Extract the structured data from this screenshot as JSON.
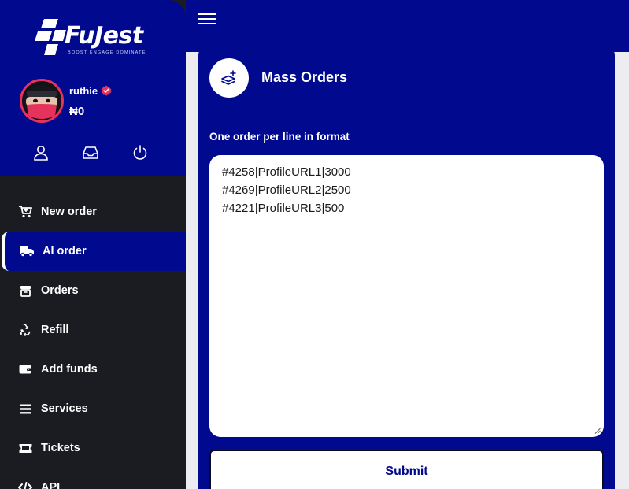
{
  "brand": {
    "name": "FuJest",
    "tagline": "BOOST  ENGAGE  DOMINATE"
  },
  "user": {
    "name": "ruthie",
    "balance": "₦0"
  },
  "nav": [
    {
      "label": "New order",
      "icon": "cart-icon"
    },
    {
      "label": "AI order",
      "icon": "truck-icon",
      "active": true
    },
    {
      "label": "Orders",
      "icon": "box-icon"
    },
    {
      "label": "Refill",
      "icon": "recycle-icon"
    },
    {
      "label": "Add funds",
      "icon": "wallet-icon"
    },
    {
      "label": "Services",
      "icon": "list-icon"
    },
    {
      "label": "Tickets",
      "icon": "ticket-icon"
    },
    {
      "label": "API",
      "icon": "code-icon"
    }
  ],
  "main": {
    "title": "Mass Orders",
    "format_label": "One order per line in format",
    "orders_text": "#4258|ProfileURL1|3000\n#4269|ProfileURL2|2500\n#4221|ProfileURL3|500",
    "submit_label": "Submit"
  },
  "colors": {
    "primary": "#01098e",
    "sidebar": "#1b1c22",
    "accent": "#e6335d",
    "background": "#ececf1"
  }
}
